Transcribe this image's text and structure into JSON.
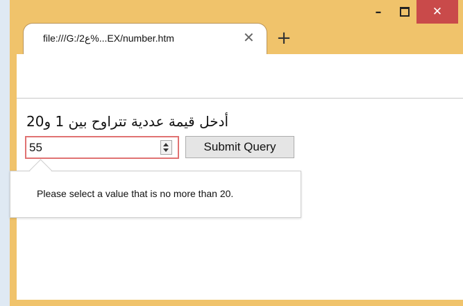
{
  "window": {
    "minimize_label": "–",
    "close_label": "✕"
  },
  "tab": {
    "title": "file:///G:/2ع%...EX/number.htm",
    "close_label": "✕"
  },
  "new_tab_label": "+",
  "page": {
    "prompt": "أدخل قيمة عددية تتراوح بين 1 و20",
    "number_value": "55",
    "submit_label": "Submit Query",
    "validation_message": "Please select a value that is no more than 20."
  },
  "colors": {
    "window_frame": "#f0c36b",
    "close_button": "#c94a4a",
    "invalid_border": "#e07272"
  }
}
